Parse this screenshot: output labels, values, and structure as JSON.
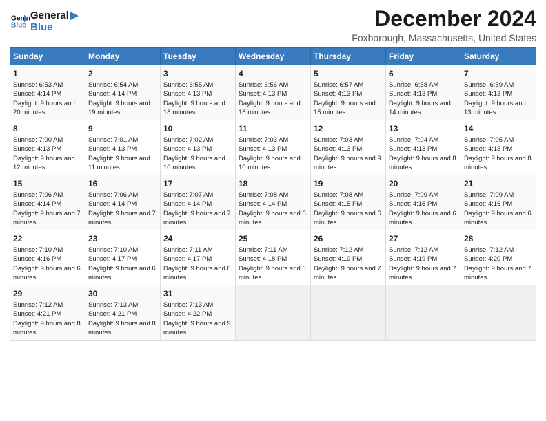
{
  "logo": {
    "line1": "General",
    "line2": "Blue"
  },
  "header": {
    "title": "December 2024",
    "subtitle": "Foxborough, Massachusetts, United States"
  },
  "days_of_week": [
    "Sunday",
    "Monday",
    "Tuesday",
    "Wednesday",
    "Thursday",
    "Friday",
    "Saturday"
  ],
  "weeks": [
    [
      {
        "day": "1",
        "sunrise": "6:53 AM",
        "sunset": "4:14 PM",
        "daylight": "9 hours and 20 minutes."
      },
      {
        "day": "2",
        "sunrise": "6:54 AM",
        "sunset": "4:14 PM",
        "daylight": "9 hours and 19 minutes."
      },
      {
        "day": "3",
        "sunrise": "6:55 AM",
        "sunset": "4:13 PM",
        "daylight": "9 hours and 18 minutes."
      },
      {
        "day": "4",
        "sunrise": "6:56 AM",
        "sunset": "4:13 PM",
        "daylight": "9 hours and 16 minutes."
      },
      {
        "day": "5",
        "sunrise": "6:57 AM",
        "sunset": "4:13 PM",
        "daylight": "9 hours and 15 minutes."
      },
      {
        "day": "6",
        "sunrise": "6:58 AM",
        "sunset": "4:13 PM",
        "daylight": "9 hours and 14 minutes."
      },
      {
        "day": "7",
        "sunrise": "6:59 AM",
        "sunset": "4:13 PM",
        "daylight": "9 hours and 13 minutes."
      }
    ],
    [
      {
        "day": "8",
        "sunrise": "7:00 AM",
        "sunset": "4:13 PM",
        "daylight": "9 hours and 12 minutes."
      },
      {
        "day": "9",
        "sunrise": "7:01 AM",
        "sunset": "4:13 PM",
        "daylight": "9 hours and 11 minutes."
      },
      {
        "day": "10",
        "sunrise": "7:02 AM",
        "sunset": "4:13 PM",
        "daylight": "9 hours and 10 minutes."
      },
      {
        "day": "11",
        "sunrise": "7:03 AM",
        "sunset": "4:13 PM",
        "daylight": "9 hours and 10 minutes."
      },
      {
        "day": "12",
        "sunrise": "7:03 AM",
        "sunset": "4:13 PM",
        "daylight": "9 hours and 9 minutes."
      },
      {
        "day": "13",
        "sunrise": "7:04 AM",
        "sunset": "4:13 PM",
        "daylight": "9 hours and 8 minutes."
      },
      {
        "day": "14",
        "sunrise": "7:05 AM",
        "sunset": "4:13 PM",
        "daylight": "9 hours and 8 minutes."
      }
    ],
    [
      {
        "day": "15",
        "sunrise": "7:06 AM",
        "sunset": "4:14 PM",
        "daylight": "9 hours and 7 minutes."
      },
      {
        "day": "16",
        "sunrise": "7:06 AM",
        "sunset": "4:14 PM",
        "daylight": "9 hours and 7 minutes."
      },
      {
        "day": "17",
        "sunrise": "7:07 AM",
        "sunset": "4:14 PM",
        "daylight": "9 hours and 7 minutes."
      },
      {
        "day": "18",
        "sunrise": "7:08 AM",
        "sunset": "4:14 PM",
        "daylight": "9 hours and 6 minutes."
      },
      {
        "day": "19",
        "sunrise": "7:08 AM",
        "sunset": "4:15 PM",
        "daylight": "9 hours and 6 minutes."
      },
      {
        "day": "20",
        "sunrise": "7:09 AM",
        "sunset": "4:15 PM",
        "daylight": "9 hours and 6 minutes."
      },
      {
        "day": "21",
        "sunrise": "7:09 AM",
        "sunset": "4:16 PM",
        "daylight": "9 hours and 6 minutes."
      }
    ],
    [
      {
        "day": "22",
        "sunrise": "7:10 AM",
        "sunset": "4:16 PM",
        "daylight": "9 hours and 6 minutes."
      },
      {
        "day": "23",
        "sunrise": "7:10 AM",
        "sunset": "4:17 PM",
        "daylight": "9 hours and 6 minutes."
      },
      {
        "day": "24",
        "sunrise": "7:11 AM",
        "sunset": "4:17 PM",
        "daylight": "9 hours and 6 minutes."
      },
      {
        "day": "25",
        "sunrise": "7:11 AM",
        "sunset": "4:18 PM",
        "daylight": "9 hours and 6 minutes."
      },
      {
        "day": "26",
        "sunrise": "7:12 AM",
        "sunset": "4:19 PM",
        "daylight": "9 hours and 7 minutes."
      },
      {
        "day": "27",
        "sunrise": "7:12 AM",
        "sunset": "4:19 PM",
        "daylight": "9 hours and 7 minutes."
      },
      {
        "day": "28",
        "sunrise": "7:12 AM",
        "sunset": "4:20 PM",
        "daylight": "9 hours and 7 minutes."
      }
    ],
    [
      {
        "day": "29",
        "sunrise": "7:12 AM",
        "sunset": "4:21 PM",
        "daylight": "9 hours and 8 minutes."
      },
      {
        "day": "30",
        "sunrise": "7:13 AM",
        "sunset": "4:21 PM",
        "daylight": "9 hours and 8 minutes."
      },
      {
        "day": "31",
        "sunrise": "7:13 AM",
        "sunset": "4:22 PM",
        "daylight": "9 hours and 9 minutes."
      },
      null,
      null,
      null,
      null
    ]
  ],
  "labels": {
    "sunrise": "Sunrise:",
    "sunset": "Sunset:",
    "daylight": "Daylight:"
  }
}
